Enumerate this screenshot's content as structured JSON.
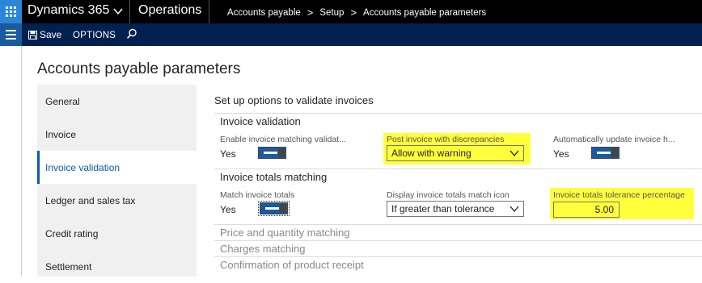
{
  "topbar": {
    "app_name": "Dynamics 365",
    "module": "Operations",
    "breadcrumbs": [
      "Accounts payable",
      "Setup",
      "Accounts payable parameters"
    ]
  },
  "actionbar": {
    "save_label": "Save",
    "options_label": "OPTIONS"
  },
  "page": {
    "title": "Accounts payable parameters"
  },
  "tabs": [
    {
      "label": "General",
      "active": false
    },
    {
      "label": "Invoice",
      "active": false
    },
    {
      "label": "Invoice validation",
      "active": true
    },
    {
      "label": "Ledger and sales tax",
      "active": false
    },
    {
      "label": "Credit rating",
      "active": false
    },
    {
      "label": "Settlement",
      "active": false
    }
  ],
  "content": {
    "heading": "Set up options to validate invoices",
    "invoice_validation": {
      "title": "Invoice validation",
      "enable_matching": {
        "label": "Enable invoice matching validat...",
        "value": "Yes"
      },
      "post_with_discrepancies": {
        "label": "Post invoice with discrepancies",
        "value": "Allow with warning"
      },
      "auto_update": {
        "label": "Automatically update invoice h...",
        "value": "Yes"
      }
    },
    "invoice_totals": {
      "title": "Invoice totals matching",
      "match_totals": {
        "label": "Match invoice totals",
        "value": "Yes"
      },
      "display_icon": {
        "label": "Display invoice totals match icon",
        "value": "If greater than tolerance"
      },
      "tolerance": {
        "label": "Invoice totals tolerance percentage",
        "value": "5.00"
      }
    },
    "collapsed_groups": [
      "Price and quantity matching",
      "Charges matching",
      "Confirmation of product receipt"
    ]
  },
  "colors": {
    "topbar": "#000000",
    "actionbar": "#002050",
    "accent": "#0c5aa8",
    "highlight": "#ffff3b"
  }
}
